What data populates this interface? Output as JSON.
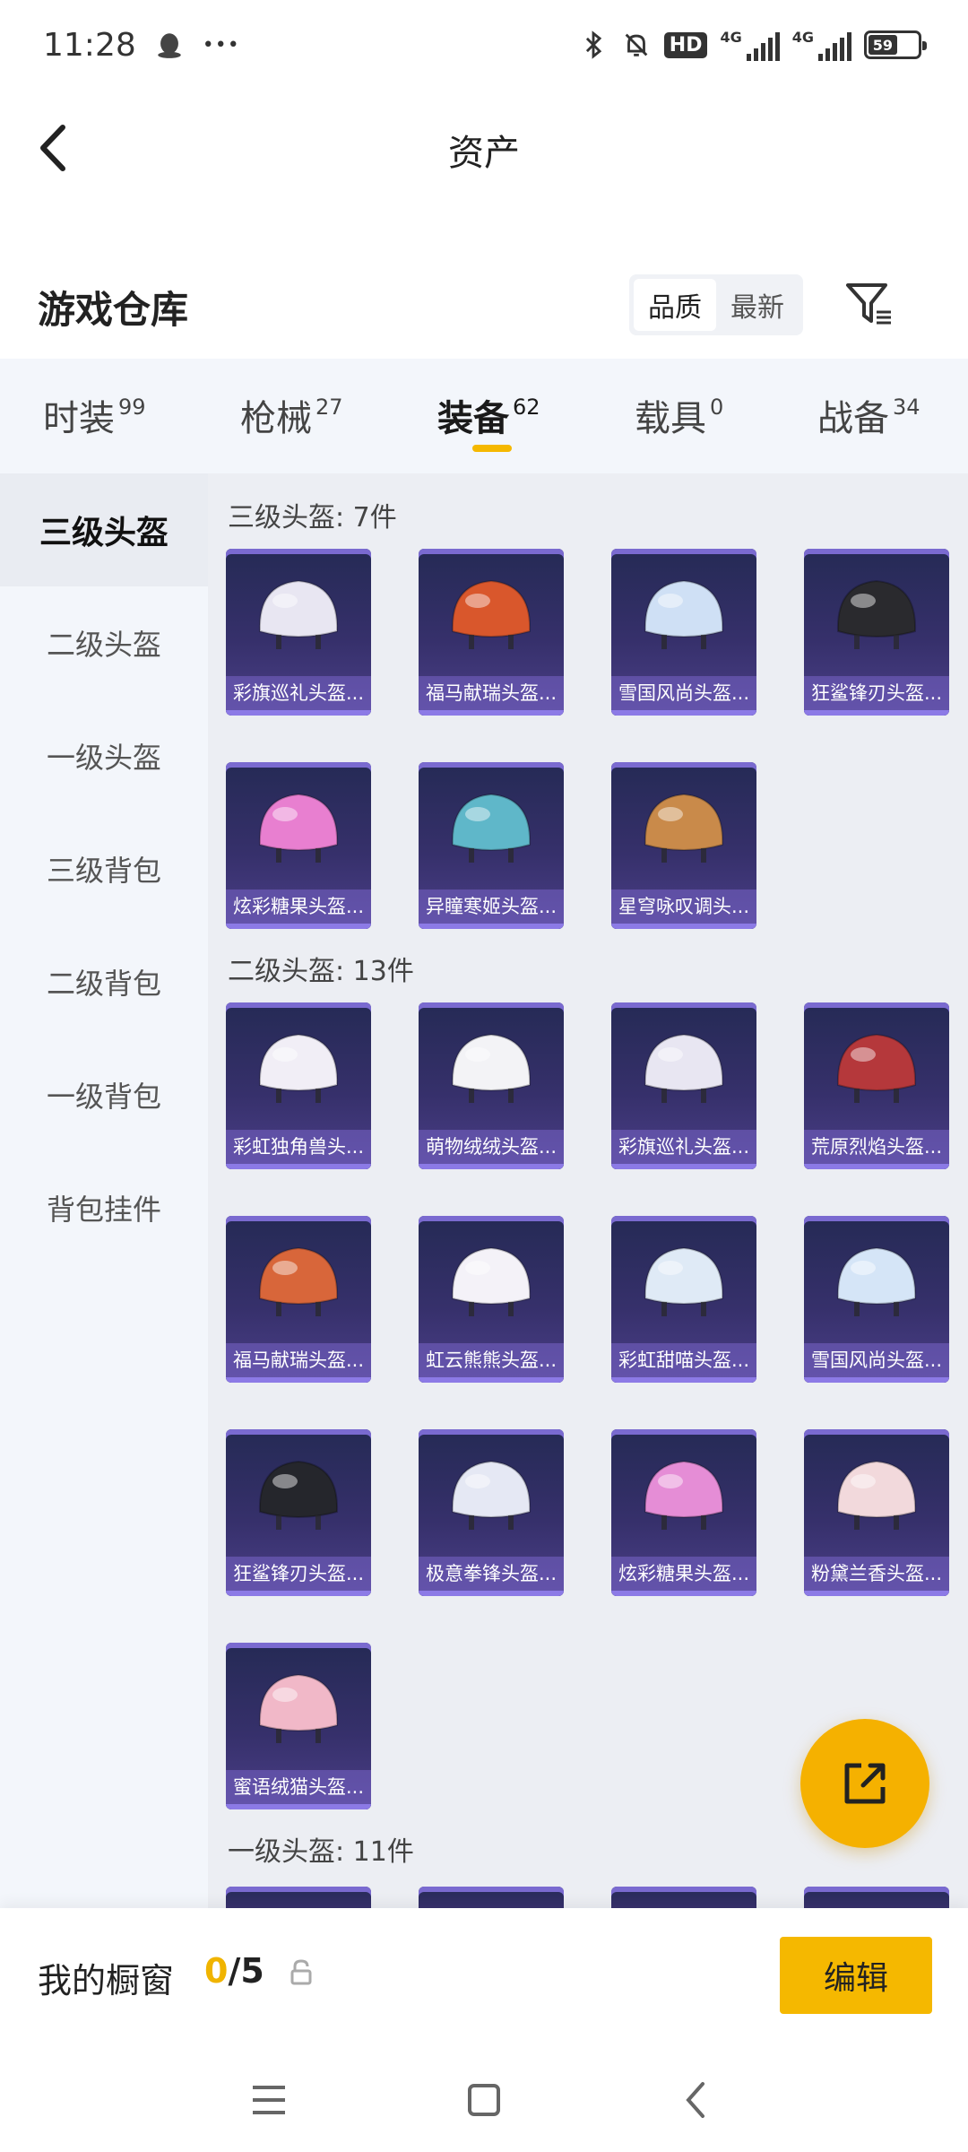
{
  "status_bar": {
    "time": "11:28",
    "more": "•••",
    "hd": "HD",
    "net1": "4G",
    "net2": "4G",
    "battery": "59"
  },
  "header": {
    "title": "资产"
  },
  "warehouse": {
    "title": "游戏仓库",
    "sort_options": [
      "品质",
      "最新"
    ],
    "sort_selected": "品质"
  },
  "tabs": [
    {
      "label": "时装",
      "count": "99"
    },
    {
      "label": "枪械",
      "count": "27"
    },
    {
      "label": "装备",
      "count": "62",
      "active": true
    },
    {
      "label": "载具",
      "count": "0"
    },
    {
      "label": "战备",
      "count": "34"
    }
  ],
  "sidebar": {
    "items": [
      {
        "label": "三级头盔",
        "active": true
      },
      {
        "label": "二级头盔"
      },
      {
        "label": "一级头盔"
      },
      {
        "label": "三级背包"
      },
      {
        "label": "二级背包"
      },
      {
        "label": "一级背包"
      },
      {
        "label": "背包挂件"
      }
    ]
  },
  "sections": [
    {
      "title": "三级头盔: 7件",
      "items": [
        {
          "name": "彩旗巡礼头盔...",
          "color": "#e8e6f2"
        },
        {
          "name": "福马献瑞头盔...",
          "color": "#d9572c"
        },
        {
          "name": "雪国风尚头盔...",
          "color": "#cfe0f5"
        },
        {
          "name": "狂鲨锋刃头盔...",
          "color": "#2a2a2e"
        },
        {
          "name": "炫彩糖果头盔...",
          "color": "#e87fd0"
        },
        {
          "name": "异瞳寒姬头盔...",
          "color": "#5fb7c9"
        },
        {
          "name": "星穹咏叹调头...",
          "color": "#c98a4a"
        }
      ]
    },
    {
      "title": "二级头盔: 13件",
      "items": [
        {
          "name": "彩虹独角兽头...",
          "color": "#f1eef6"
        },
        {
          "name": "萌物绒绒头盔...",
          "color": "#f3f3f6"
        },
        {
          "name": "彩旗巡礼头盔...",
          "color": "#e8e6f2"
        },
        {
          "name": "荒原烈焰头盔...",
          "color": "#b5383b"
        },
        {
          "name": "福马献瑞头盔...",
          "color": "#d8663a"
        },
        {
          "name": "虹云熊熊头盔...",
          "color": "#f4f2f8"
        },
        {
          "name": "彩虹甜喵头盔...",
          "color": "#dfeaf6"
        },
        {
          "name": "雪国风尚头盔...",
          "color": "#d5e5f7"
        },
        {
          "name": "狂鲨锋刃头盔...",
          "color": "#25262c"
        },
        {
          "name": "极意拳锋头盔...",
          "color": "#e5e8f4"
        },
        {
          "name": "炫彩糖果头盔...",
          "color": "#e58dd6"
        },
        {
          "name": "粉黛兰香头盔...",
          "color": "#f2d9dc"
        },
        {
          "name": "蜜语绒猫头盔...",
          "color": "#f1b8c8"
        }
      ]
    },
    {
      "title": "一级头盔: 11件"
    }
  ],
  "showcase": {
    "label": "我的橱窗",
    "current": "0",
    "separator": "/",
    "max": "5",
    "edit_label": "编辑"
  },
  "colors": {
    "accent": "#f5b800",
    "card_bg": "#2e2c60",
    "card_strip": "#8c7ae6"
  }
}
